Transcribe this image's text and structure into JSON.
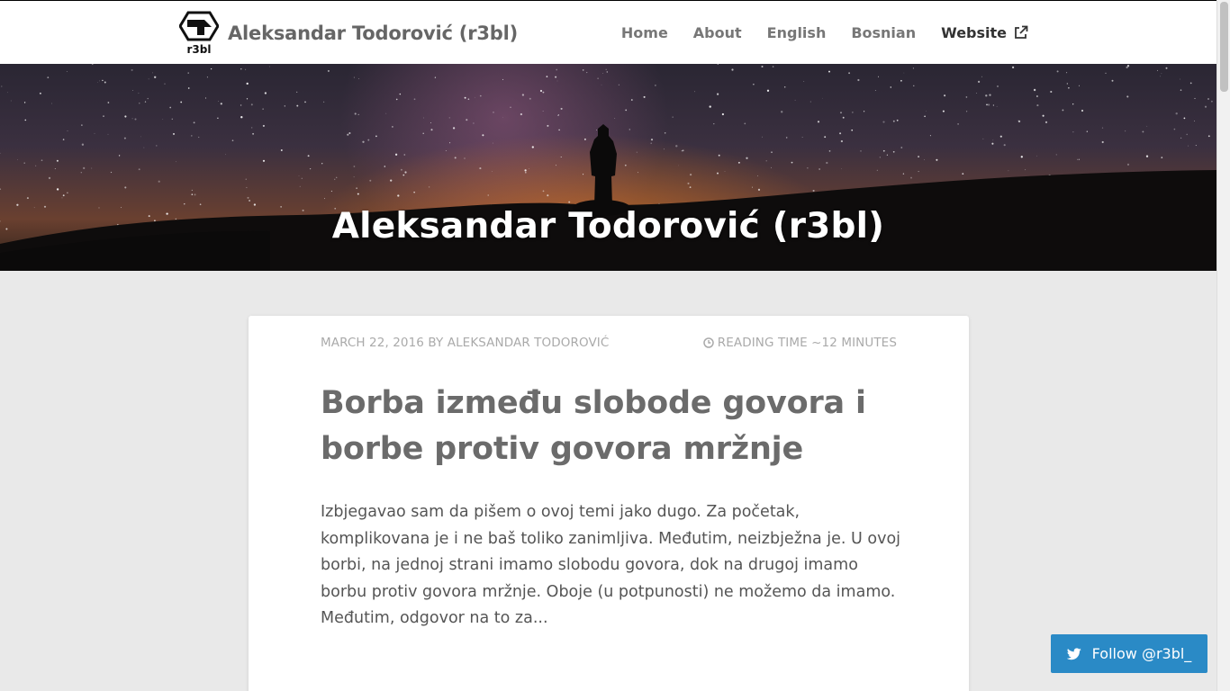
{
  "site": {
    "title": "Aleksandar Todorović (r3bl)",
    "logo_text": "r3bl"
  },
  "nav": {
    "items": [
      {
        "label": "Home"
      },
      {
        "label": "About"
      },
      {
        "label": "English"
      },
      {
        "label": "Bosnian"
      },
      {
        "label": "Website",
        "icon": "external-link-icon"
      }
    ]
  },
  "hero": {
    "title": "Aleksandar Todorović (r3bl)"
  },
  "post": {
    "date_author": "MARCH 22, 2016 BY ALEKSANDAR TODOROVIĆ",
    "reading_time": "READING TIME ~12 MINUTES",
    "title": "Borba između slobode govora i borbe protiv govora mržnje",
    "excerpt": "Izbjegavao sam da pišem o ovoj temi jako dugo. Za početak, komplikovana je i ne baš toliko zanimljiva. Međutim, neizbježna je. U ovoj borbi, na jednoj strani imamo slobodu govora, dok na drugoj imamo borbu protiv govora mržnje. Oboje (u potpunosti) ne možemo da imamo. Međutim, odgovor na to za..."
  },
  "follow": {
    "label": "Follow @r3bl_",
    "icon": "twitter-icon"
  },
  "colors": {
    "accent": "#2a8ac6",
    "page_bg": "#e9e9e9",
    "title_text": "#6b6b6b"
  }
}
